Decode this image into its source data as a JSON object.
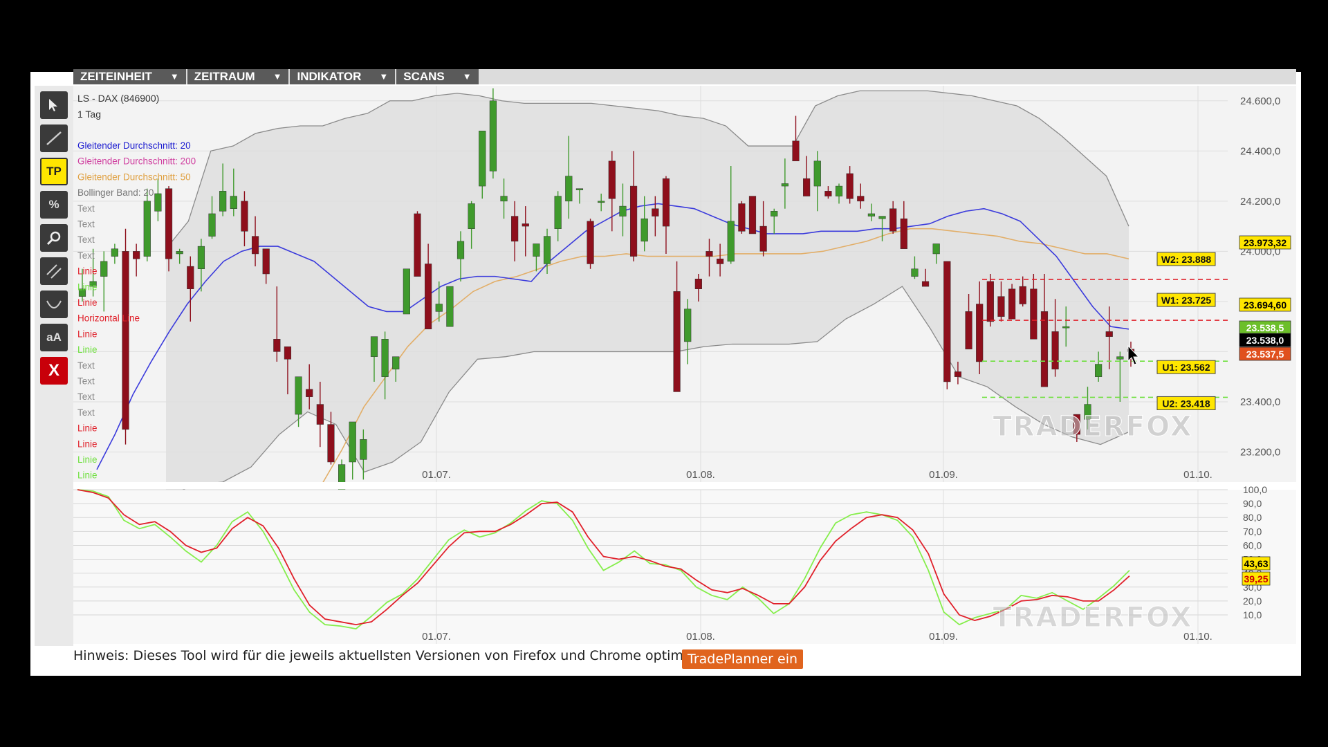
{
  "menu": {
    "items": [
      {
        "label": "ZEITEINHEIT"
      },
      {
        "label": "ZEITRAUM"
      },
      {
        "label": "INDIKATOR"
      },
      {
        "label": "SCANS"
      }
    ],
    "caret": "▼"
  },
  "toolbar": {
    "tools": [
      {
        "name": "cursor-icon",
        "label": ""
      },
      {
        "name": "line-tool-icon",
        "label": ""
      },
      {
        "name": "tp-button",
        "label": "TP"
      },
      {
        "name": "percent-icon",
        "label": "%"
      },
      {
        "name": "magnifier-icon",
        "label": ""
      },
      {
        "name": "parallel-lines-icon",
        "label": ""
      },
      {
        "name": "curve-icon",
        "label": ""
      },
      {
        "name": "text-tool-button",
        "label": "aA"
      },
      {
        "name": "delete-button",
        "label": "X"
      }
    ]
  },
  "instrument": {
    "name": "LS - DAX (846900)",
    "period": "1 Tag"
  },
  "legend": [
    {
      "label": "Gleitender Durchschnitt: 20",
      "color": "#1a1ad0"
    },
    {
      "label": "Gleitender Durchschnitt: 200",
      "color": "#d040a0"
    },
    {
      "label": "Gleitender Durchschnitt: 50",
      "color": "#e0a040"
    },
    {
      "label": "Bollinger Band: 20",
      "color": "#777777"
    },
    {
      "label": "Text",
      "color": "#888888"
    },
    {
      "label": "Text",
      "color": "#888888"
    },
    {
      "label": "Text",
      "color": "#888888"
    },
    {
      "label": "Text",
      "color": "#888888"
    },
    {
      "label": "Linie",
      "color": "#e0202a"
    },
    {
      "label": "Linie",
      "color": "#70e040"
    },
    {
      "label": "Linie",
      "color": "#e0202a"
    },
    {
      "label": "Horizontal Line",
      "color": "#e0202a"
    },
    {
      "label": "Linie",
      "color": "#e0202a"
    },
    {
      "label": "Linie",
      "color": "#70e040"
    },
    {
      "label": "Text",
      "color": "#888888"
    },
    {
      "label": "Text",
      "color": "#888888"
    },
    {
      "label": "Text",
      "color": "#888888"
    },
    {
      "label": "Text",
      "color": "#888888"
    },
    {
      "label": "Linie",
      "color": "#e0202a"
    },
    {
      "label": "Linie",
      "color": "#e0202a"
    },
    {
      "label": "Linie",
      "color": "#70e040"
    },
    {
      "label": "Linie",
      "color": "#70e040"
    }
  ],
  "colors": {
    "bull": "#3f9a2c",
    "bear": "#8e0f1c",
    "ma20": "#3b3bdc",
    "ma50": "#e2ae68",
    "band": "#8a8a8a",
    "stoch_k": "#86ee4c",
    "stoch_d": "#e0202a"
  },
  "chart_data": [
    {
      "type": "candlestick",
      "x_ticks": [
        "01.07.",
        "01.08.",
        "01.09.",
        "01.10."
      ],
      "y_ticks": [
        "23.200,0",
        "23.400,0",
        "23.600,0",
        "23.800,0",
        "24.000,0",
        "24.200,0",
        "24.400,0",
        "24.600,0"
      ],
      "ylim": [
        23080,
        24660
      ],
      "ohlc": [
        [
          23820,
          23930,
          23800,
          23850
        ],
        [
          23860,
          24010,
          23820,
          23880
        ],
        [
          23900,
          24000,
          23760,
          23960
        ],
        [
          23980,
          24030,
          23950,
          24010
        ],
        [
          24000,
          24090,
          23230,
          23290
        ],
        [
          24000,
          24030,
          23900,
          23970
        ],
        [
          23980,
          24250,
          23960,
          24200
        ],
        [
          24160,
          24290,
          24120,
          24230
        ],
        [
          24250,
          24260,
          23920,
          23970
        ],
        [
          23990,
          24010,
          23950,
          24000
        ],
        [
          23940,
          23980,
          23720,
          23850
        ],
        [
          23930,
          24050,
          23840,
          24020
        ],
        [
          24060,
          24220,
          24050,
          24150
        ],
        [
          24160,
          24350,
          24140,
          24240
        ],
        [
          24170,
          24330,
          24140,
          24220
        ],
        [
          24200,
          24240,
          24020,
          24080
        ],
        [
          24060,
          24140,
          23940,
          23990
        ],
        [
          24010,
          24010,
          23870,
          23910
        ],
        [
          23650,
          23860,
          23560,
          23600
        ],
        [
          23620,
          23620,
          23430,
          23570
        ],
        [
          23350,
          23470,
          23300,
          23500
        ],
        [
          23450,
          23550,
          23370,
          23420
        ],
        [
          23390,
          23480,
          23220,
          23310
        ],
        [
          23310,
          23360,
          23150,
          23160
        ],
        [
          23040,
          23170,
          23040,
          23150
        ],
        [
          23160,
          23300,
          23090,
          23320
        ],
        [
          23170,
          23290,
          23090,
          23250
        ],
        [
          23580,
          23620,
          23480,
          23660
        ],
        [
          23500,
          23680,
          23410,
          23650
        ],
        [
          23530,
          23560,
          23480,
          23580
        ],
        [
          23750,
          23920,
          23770,
          23930
        ],
        [
          24150,
          24160,
          23960,
          23900
        ],
        [
          23950,
          24030,
          23690,
          23690
        ],
        [
          23760,
          23880,
          23720,
          23790
        ],
        [
          23700,
          23860,
          23770,
          23860
        ],
        [
          23970,
          24080,
          23880,
          24040
        ],
        [
          24090,
          24200,
          24010,
          24190
        ],
        [
          24260,
          24450,
          24210,
          24480
        ],
        [
          24320,
          24650,
          24290,
          24600
        ],
        [
          24200,
          24290,
          24130,
          24220
        ],
        [
          24140,
          24200,
          23960,
          24040
        ],
        [
          24110,
          24180,
          23980,
          24100
        ],
        [
          23980,
          24010,
          23920,
          24030
        ],
        [
          23950,
          24090,
          23910,
          24060
        ],
        [
          24090,
          24240,
          24040,
          24220
        ],
        [
          24200,
          24460,
          24130,
          24300
        ],
        [
          24250,
          24250,
          24190,
          24250
        ],
        [
          24120,
          24130,
          23930,
          23950
        ],
        [
          24200,
          24230,
          24160,
          24200
        ],
        [
          24360,
          24400,
          24080,
          24210
        ],
        [
          24140,
          24270,
          24060,
          24180
        ],
        [
          24260,
          24400,
          23960,
          23980
        ],
        [
          24040,
          24220,
          24000,
          24130
        ],
        [
          24170,
          24220,
          24060,
          24140
        ],
        [
          24290,
          24300,
          23990,
          24100
        ],
        [
          23840,
          23960,
          23470,
          23440
        ],
        [
          23640,
          23810,
          23550,
          23770
        ],
        [
          23890,
          23910,
          23800,
          23850
        ],
        [
          24000,
          24050,
          23900,
          23980
        ],
        [
          23970,
          24030,
          23900,
          23950
        ],
        [
          23960,
          24340,
          23950,
          24120
        ],
        [
          24190,
          24200,
          24070,
          24080
        ],
        [
          24220,
          24210,
          24100,
          24070
        ],
        [
          24100,
          24200,
          23980,
          24000
        ],
        [
          24140,
          24170,
          24070,
          24160
        ],
        [
          24260,
          24370,
          24170,
          24270
        ],
        [
          24440,
          24540,
          24380,
          24360
        ],
        [
          24290,
          24380,
          24260,
          24220
        ],
        [
          24260,
          24400,
          24160,
          24360
        ],
        [
          24240,
          24260,
          24210,
          24220
        ],
        [
          24220,
          24270,
          24190,
          24260
        ],
        [
          24310,
          24340,
          24190,
          24210
        ],
        [
          24220,
          24270,
          24170,
          24200
        ],
        [
          24140,
          24190,
          24120,
          24150
        ],
        [
          24130,
          24140,
          24040,
          24140
        ],
        [
          24170,
          24200,
          24070,
          24080
        ],
        [
          24130,
          24200,
          24010,
          24010
        ],
        [
          23900,
          23980,
          23890,
          23930
        ],
        [
          23880,
          23930,
          23860,
          23860
        ],
        [
          23990,
          24020,
          23950,
          24030
        ],
        [
          23960,
          23960,
          23450,
          23480
        ],
        [
          23520,
          23560,
          23470,
          23500
        ],
        [
          23760,
          23830,
          23620,
          23610
        ],
        [
          23790,
          23880,
          23510,
          23560
        ],
        [
          23880,
          23910,
          23700,
          23720
        ],
        [
          23820,
          23880,
          23720,
          23740
        ],
        [
          23850,
          23870,
          23750,
          23730
        ],
        [
          23860,
          23900,
          23780,
          23790
        ],
        [
          23850,
          23910,
          23740,
          23650
        ],
        [
          23760,
          23910,
          23480,
          23460
        ],
        [
          23680,
          23810,
          23500,
          23530
        ],
        [
          23700,
          23780,
          23620,
          23700
        ],
        [
          23350,
          23350,
          23240,
          23270
        ],
        [
          23330,
          23460,
          23290,
          23390
        ],
        [
          23500,
          23600,
          23480,
          23550
        ],
        [
          23680,
          23780,
          23530,
          23660
        ],
        [
          23570,
          23600,
          23400,
          23580
        ],
        [
          23610,
          23640,
          23540,
          23600
        ]
      ],
      "ma20": [
        23130,
        23270,
        23430,
        23560,
        23680,
        23790,
        23880,
        23960,
        24000,
        24020,
        24020,
        23990,
        23960,
        23900,
        23840,
        23780,
        23760,
        23760,
        23810,
        23860,
        23890,
        23900,
        23900,
        23890,
        23880,
        23960,
        24020,
        24080,
        24120,
        24160,
        24180,
        24190,
        24180,
        24170,
        24140,
        24110,
        24090,
        24070,
        24070,
        24070,
        24080,
        24080,
        24080,
        24090,
        24090,
        24100,
        24110,
        24140,
        24160,
        24170,
        24150,
        24120,
        24050,
        23980,
        23880,
        23780,
        23700,
        23690
      ],
      "ma50": [
        23060,
        23210,
        23380,
        23500,
        23620,
        23710,
        23770,
        23840,
        23880,
        23900,
        23930,
        23960,
        23980,
        23980,
        23990,
        23980,
        23980,
        23980,
        23980,
        23990,
        23990,
        23990,
        23990,
        24000,
        24020,
        24040,
        24070,
        24090,
        24090,
        24080,
        24070,
        24060,
        24040,
        24030,
        24010,
        23990,
        23990,
        23970
      ],
      "bb_upper": [
        24010,
        24120,
        24400,
        24420,
        24470,
        24490,
        24500,
        24500,
        24530,
        24550,
        24600,
        24600,
        24620,
        24630,
        24620,
        24600,
        24590,
        24590,
        24590,
        24590,
        24580,
        24570,
        24560,
        24540,
        24530,
        24500,
        24420,
        24420,
        24420,
        24580,
        24620,
        24640,
        24640,
        24640,
        24640,
        24630,
        24620,
        24600,
        24580,
        24530,
        24460,
        24380,
        24300,
        24100
      ],
      "bb_lower": [
        23020,
        23070,
        23080,
        23140,
        23270,
        23360,
        23310,
        23120,
        23160,
        23240,
        23440,
        23570,
        23580,
        23600,
        23600,
        23600,
        23600,
        23600,
        23600,
        23620,
        23630,
        23630,
        23630,
        23640,
        23730,
        23790,
        23860,
        23690,
        23500,
        23460,
        23380,
        23310,
        23260,
        23230,
        23280
      ],
      "right_labels": [
        {
          "text": "23.973,32",
          "value": 23973,
          "bg": "#ffe600",
          "fg": "#000"
        },
        {
          "text": "23.694,60",
          "value": 23695,
          "bg": "#ffe600",
          "fg": "#000"
        },
        {
          "text": "23.538,5",
          "value": 23538,
          "bg": "#6cbf2a",
          "fg": "#fff"
        },
        {
          "text": "23.538,0",
          "value": 23538,
          "bg": "#000",
          "fg": "#fff"
        },
        {
          "text": "23.537,5",
          "value": 23537,
          "bg": "#e0501e",
          "fg": "#fff"
        }
      ],
      "levels": [
        {
          "text": "W2: 23.888",
          "value": 23888,
          "color": "#e0202a"
        },
        {
          "text": "W1: 23.725",
          "value": 23725,
          "color": "#e0202a"
        },
        {
          "text": "U1: 23.562",
          "value": 23562,
          "color": "#70e040"
        },
        {
          "text": "U2: 23.418",
          "value": 23418,
          "color": "#70e040"
        }
      ]
    },
    {
      "type": "line",
      "title": "",
      "x_ticks": [
        "01.07.",
        "01.08.",
        "01.09.",
        "01.10."
      ],
      "y_ticks": [
        "100,0",
        "90,0",
        "80,0",
        "70,0",
        "60,0",
        "50,0",
        "40,0",
        "30,0",
        "20,0",
        "10,0"
      ],
      "ylim": [
        0,
        100
      ],
      "series": [
        {
          "values": [
            100,
            99,
            95,
            78,
            72,
            75,
            66,
            56,
            48,
            60,
            77,
            84,
            70,
            50,
            28,
            12,
            3,
            2,
            0,
            9,
            19,
            25,
            36,
            50,
            64,
            71,
            66,
            69,
            76,
            85,
            92,
            90,
            78,
            58,
            42,
            48,
            56,
            47,
            46,
            42,
            30,
            24,
            21,
            30,
            22,
            11,
            18,
            36,
            58,
            76,
            82,
            84,
            82,
            78,
            66,
            42,
            12,
            3,
            8,
            11,
            14,
            24,
            22,
            26,
            20,
            14,
            22,
            31,
            42
          ]
        },
        {
          "values": [
            100,
            98,
            94,
            82,
            75,
            77,
            70,
            60,
            55,
            58,
            72,
            80,
            74,
            58,
            36,
            17,
            7,
            5,
            3,
            5,
            14,
            24,
            33,
            46,
            59,
            69,
            70,
            70,
            75,
            82,
            90,
            91,
            84,
            66,
            52,
            50,
            52,
            49,
            45,
            43,
            35,
            28,
            26,
            29,
            24,
            18,
            18,
            30,
            49,
            63,
            72,
            80,
            82,
            80,
            71,
            54,
            25,
            10,
            6,
            9,
            14,
            20,
            21,
            24,
            23,
            20,
            20,
            28,
            38
          ]
        }
      ],
      "right_labels": [
        {
          "text": "43,63",
          "value": 43.63,
          "bg": "#ffe600",
          "fg": "#000"
        },
        {
          "text": "39,25",
          "value": 39.25,
          "bg": "#ffe600",
          "fg": "#c00"
        }
      ]
    }
  ],
  "watermark": "TRADERFOX",
  "footer": {
    "hint": "Hinweis: Dieses Tool wird für die jeweils aktuellsten Versionen von Firefox und Chrome optimiert!",
    "button": "TradePlanner ein"
  }
}
